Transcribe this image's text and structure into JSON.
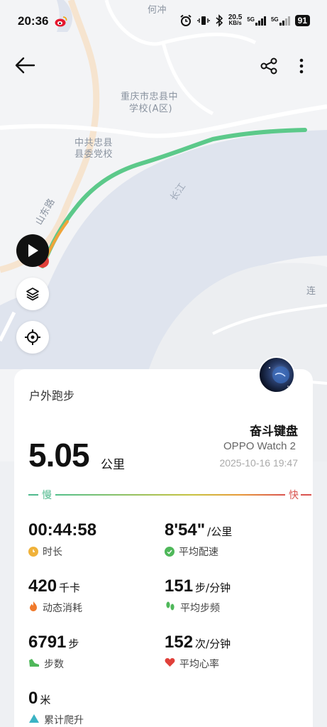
{
  "status_bar": {
    "time": "20:36",
    "net_speed": "20.5",
    "net_unit": "KB/s",
    "signal1": "5G",
    "signal2": "5G",
    "battery": "91"
  },
  "map": {
    "labels": {
      "hechong": "何冲",
      "school_line1": "重庆市忠县中",
      "school_line2": "学校(A区)",
      "party_line1": "中共忠县",
      "party_line2": "县委党校",
      "river": "长江",
      "road": "山东路",
      "lian": "连"
    }
  },
  "card": {
    "activity": "户外跑步",
    "user_name": "奋斗键盘",
    "device": "OPPO Watch 2",
    "datetime": "2025-10-16 19:47",
    "distance_value": "5.05",
    "distance_unit": "公里",
    "pace_legend": {
      "slow": "慢",
      "fast": "快"
    },
    "metrics": {
      "duration": {
        "value": "00:44:58",
        "unit": "",
        "label": "时长",
        "color": "#f0b23a"
      },
      "avg_pace": {
        "value": "8'54\"",
        "unit": "/公里",
        "label": "平均配速",
        "color": "#4fb85a"
      },
      "calories": {
        "value": "420",
        "unit": "千卡",
        "label": "动态消耗",
        "color": "#f07a2c"
      },
      "cadence": {
        "value": "151",
        "unit": "步/分钟",
        "label": "平均步频",
        "color": "#4fb85a"
      },
      "steps": {
        "value": "6791",
        "unit": "步",
        "label": "步数",
        "color": "#4fb85a"
      },
      "heart_rate": {
        "value": "152",
        "unit": "次/分钟",
        "label": "平均心率",
        "color": "#e0403a"
      },
      "elevation": {
        "value": "0",
        "unit": "米",
        "label": "累计爬升",
        "color": "#3bb3c4"
      }
    }
  },
  "icons": {
    "back": "arrow-left-icon",
    "share": "share-icon",
    "more": "more-vertical-icon",
    "play": "play-icon",
    "layers": "layers-icon",
    "locate": "locate-icon"
  }
}
